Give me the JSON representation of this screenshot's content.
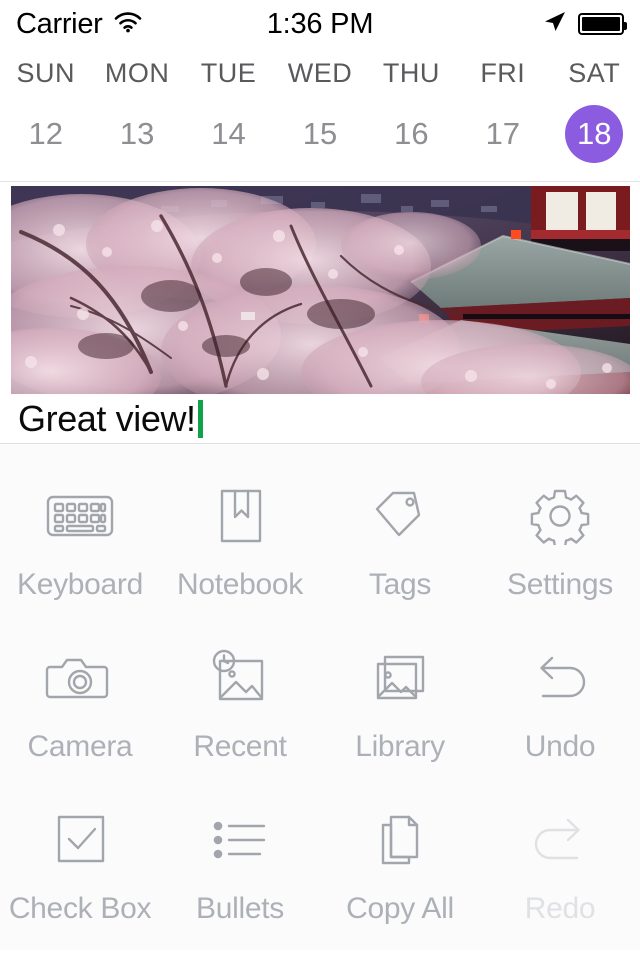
{
  "status_bar": {
    "carrier": "Carrier",
    "wifi_icon": "wifi-icon",
    "time": "1:36 PM",
    "location_icon": "location-arrow-icon",
    "battery_icon": "battery-full-icon"
  },
  "calendar": {
    "day_names": [
      "SUN",
      "MON",
      "TUE",
      "WED",
      "THU",
      "FRI",
      "SAT"
    ],
    "dates": [
      "12",
      "13",
      "14",
      "15",
      "16",
      "17",
      "18"
    ],
    "selected_index": 6,
    "selected_date": "18",
    "selected_color": "#8b5ce0"
  },
  "photo": {
    "name": "cherry-blossom-temple-photo",
    "alt": "Cherry blossom trees with Japanese temple roofs"
  },
  "note": {
    "text": "Great view!",
    "placeholder": "",
    "caret_color": "#12a04a"
  },
  "toolbar": {
    "rows": [
      [
        {
          "label": "Keyboard",
          "icon": "keyboard-icon",
          "enabled": true
        },
        {
          "label": "Notebook",
          "icon": "notebook-icon",
          "enabled": true
        },
        {
          "label": "Tags",
          "icon": "tag-icon",
          "enabled": true
        },
        {
          "label": "Settings",
          "icon": "gear-icon",
          "enabled": true
        }
      ],
      [
        {
          "label": "Camera",
          "icon": "camera-icon",
          "enabled": true
        },
        {
          "label": "Recent",
          "icon": "recent-photo-icon",
          "enabled": true
        },
        {
          "label": "Library",
          "icon": "photo-library-icon",
          "enabled": true
        },
        {
          "label": "Undo",
          "icon": "undo-arrow-icon",
          "enabled": true
        }
      ],
      [
        {
          "label": "Check Box",
          "icon": "checkbox-icon",
          "enabled": true
        },
        {
          "label": "Bullets",
          "icon": "bullet-list-icon",
          "enabled": true
        },
        {
          "label": "Copy All",
          "icon": "copy-documents-icon",
          "enabled": true
        },
        {
          "label": "Redo",
          "icon": "redo-arrow-icon",
          "enabled": false
        }
      ]
    ],
    "icon_color": "#a2a6ac",
    "label_color": "#adb1b7",
    "disabled_color": "#dfe1e4"
  }
}
